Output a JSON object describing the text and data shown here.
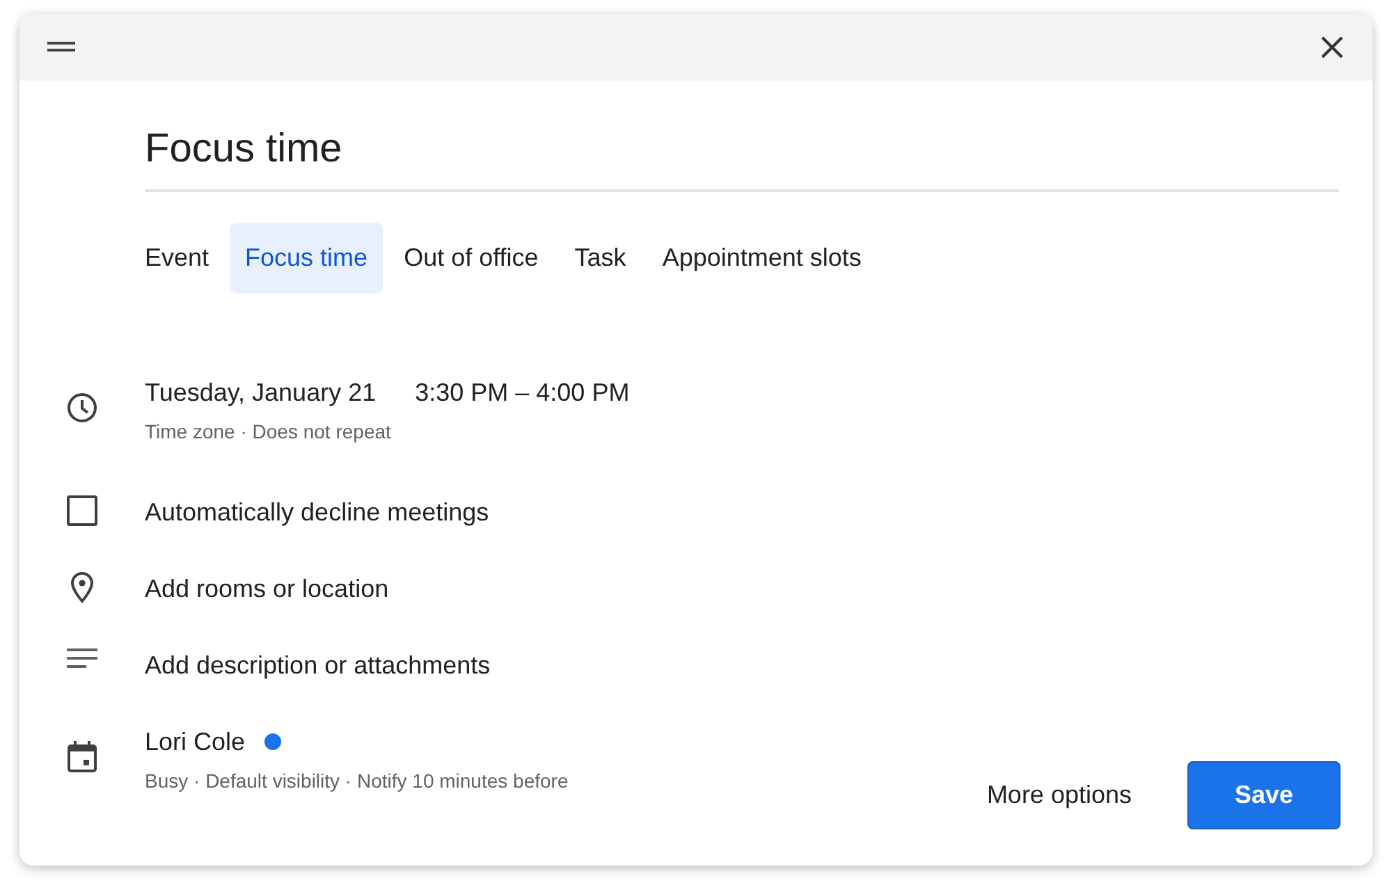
{
  "dialog": {
    "title_value": "Focus time",
    "tabs": [
      {
        "label": "Event",
        "selected": false
      },
      {
        "label": "Focus time",
        "selected": true
      },
      {
        "label": "Out of office",
        "selected": false
      },
      {
        "label": "Task",
        "selected": false
      },
      {
        "label": "Appointment slots",
        "selected": false
      }
    ],
    "rows": [
      {
        "kind": "datetime",
        "date": "Tuesday, January 21",
        "time": "3:30 PM – 4:00 PM",
        "detail": "Time zone · Does not repeat"
      },
      {
        "kind": "checkbox",
        "label": "Automatically decline meetings",
        "checked": false
      },
      {
        "kind": "location",
        "label": "Add rooms or location"
      },
      {
        "kind": "description",
        "label": "Add description or attachments"
      },
      {
        "kind": "calendar",
        "label": "Lori Cole",
        "color": "#1a73e8",
        "detail": "Busy · Default visibility · Notify 10 minutes before"
      }
    ],
    "buttons": [
      {
        "kind": "text",
        "label": "More options"
      },
      {
        "kind": "primary",
        "label": "Save"
      }
    ]
  }
}
